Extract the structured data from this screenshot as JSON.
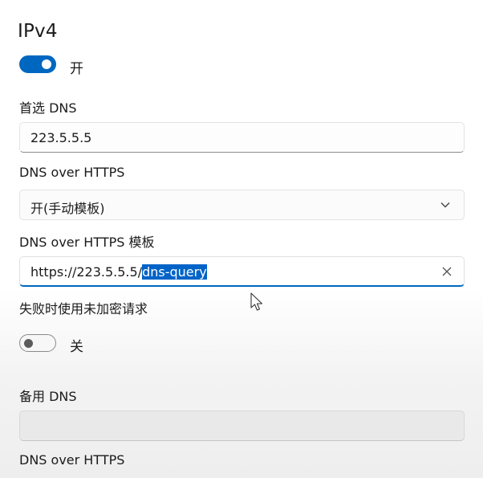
{
  "ipv4": {
    "title": "IPv4",
    "toggle_state_label": "开",
    "toggle_on": true
  },
  "preferred_dns": {
    "label": "首选 DNS",
    "value": "223.5.5.5"
  },
  "doh": {
    "label": "DNS over HTTPS",
    "selected_option": "开(手动模板)"
  },
  "doh_template": {
    "label": "DNS over HTTPS 模板",
    "value_prefix": "https://223.5.5.5/",
    "value_selected": "dns-query"
  },
  "fallback": {
    "label": "失败时使用未加密请求",
    "toggle_state_label": "关",
    "toggle_on": false
  },
  "alternate_dns": {
    "label": "备用 DNS",
    "value": ""
  },
  "alternate_doh": {
    "label": "DNS over HTTPS"
  },
  "colors": {
    "accent": "#0067c0",
    "selection": "#0063c7"
  },
  "icons": {
    "dropdown": "chevron-down-icon",
    "clear": "close-icon",
    "pointer": "mouse-cursor-icon"
  }
}
